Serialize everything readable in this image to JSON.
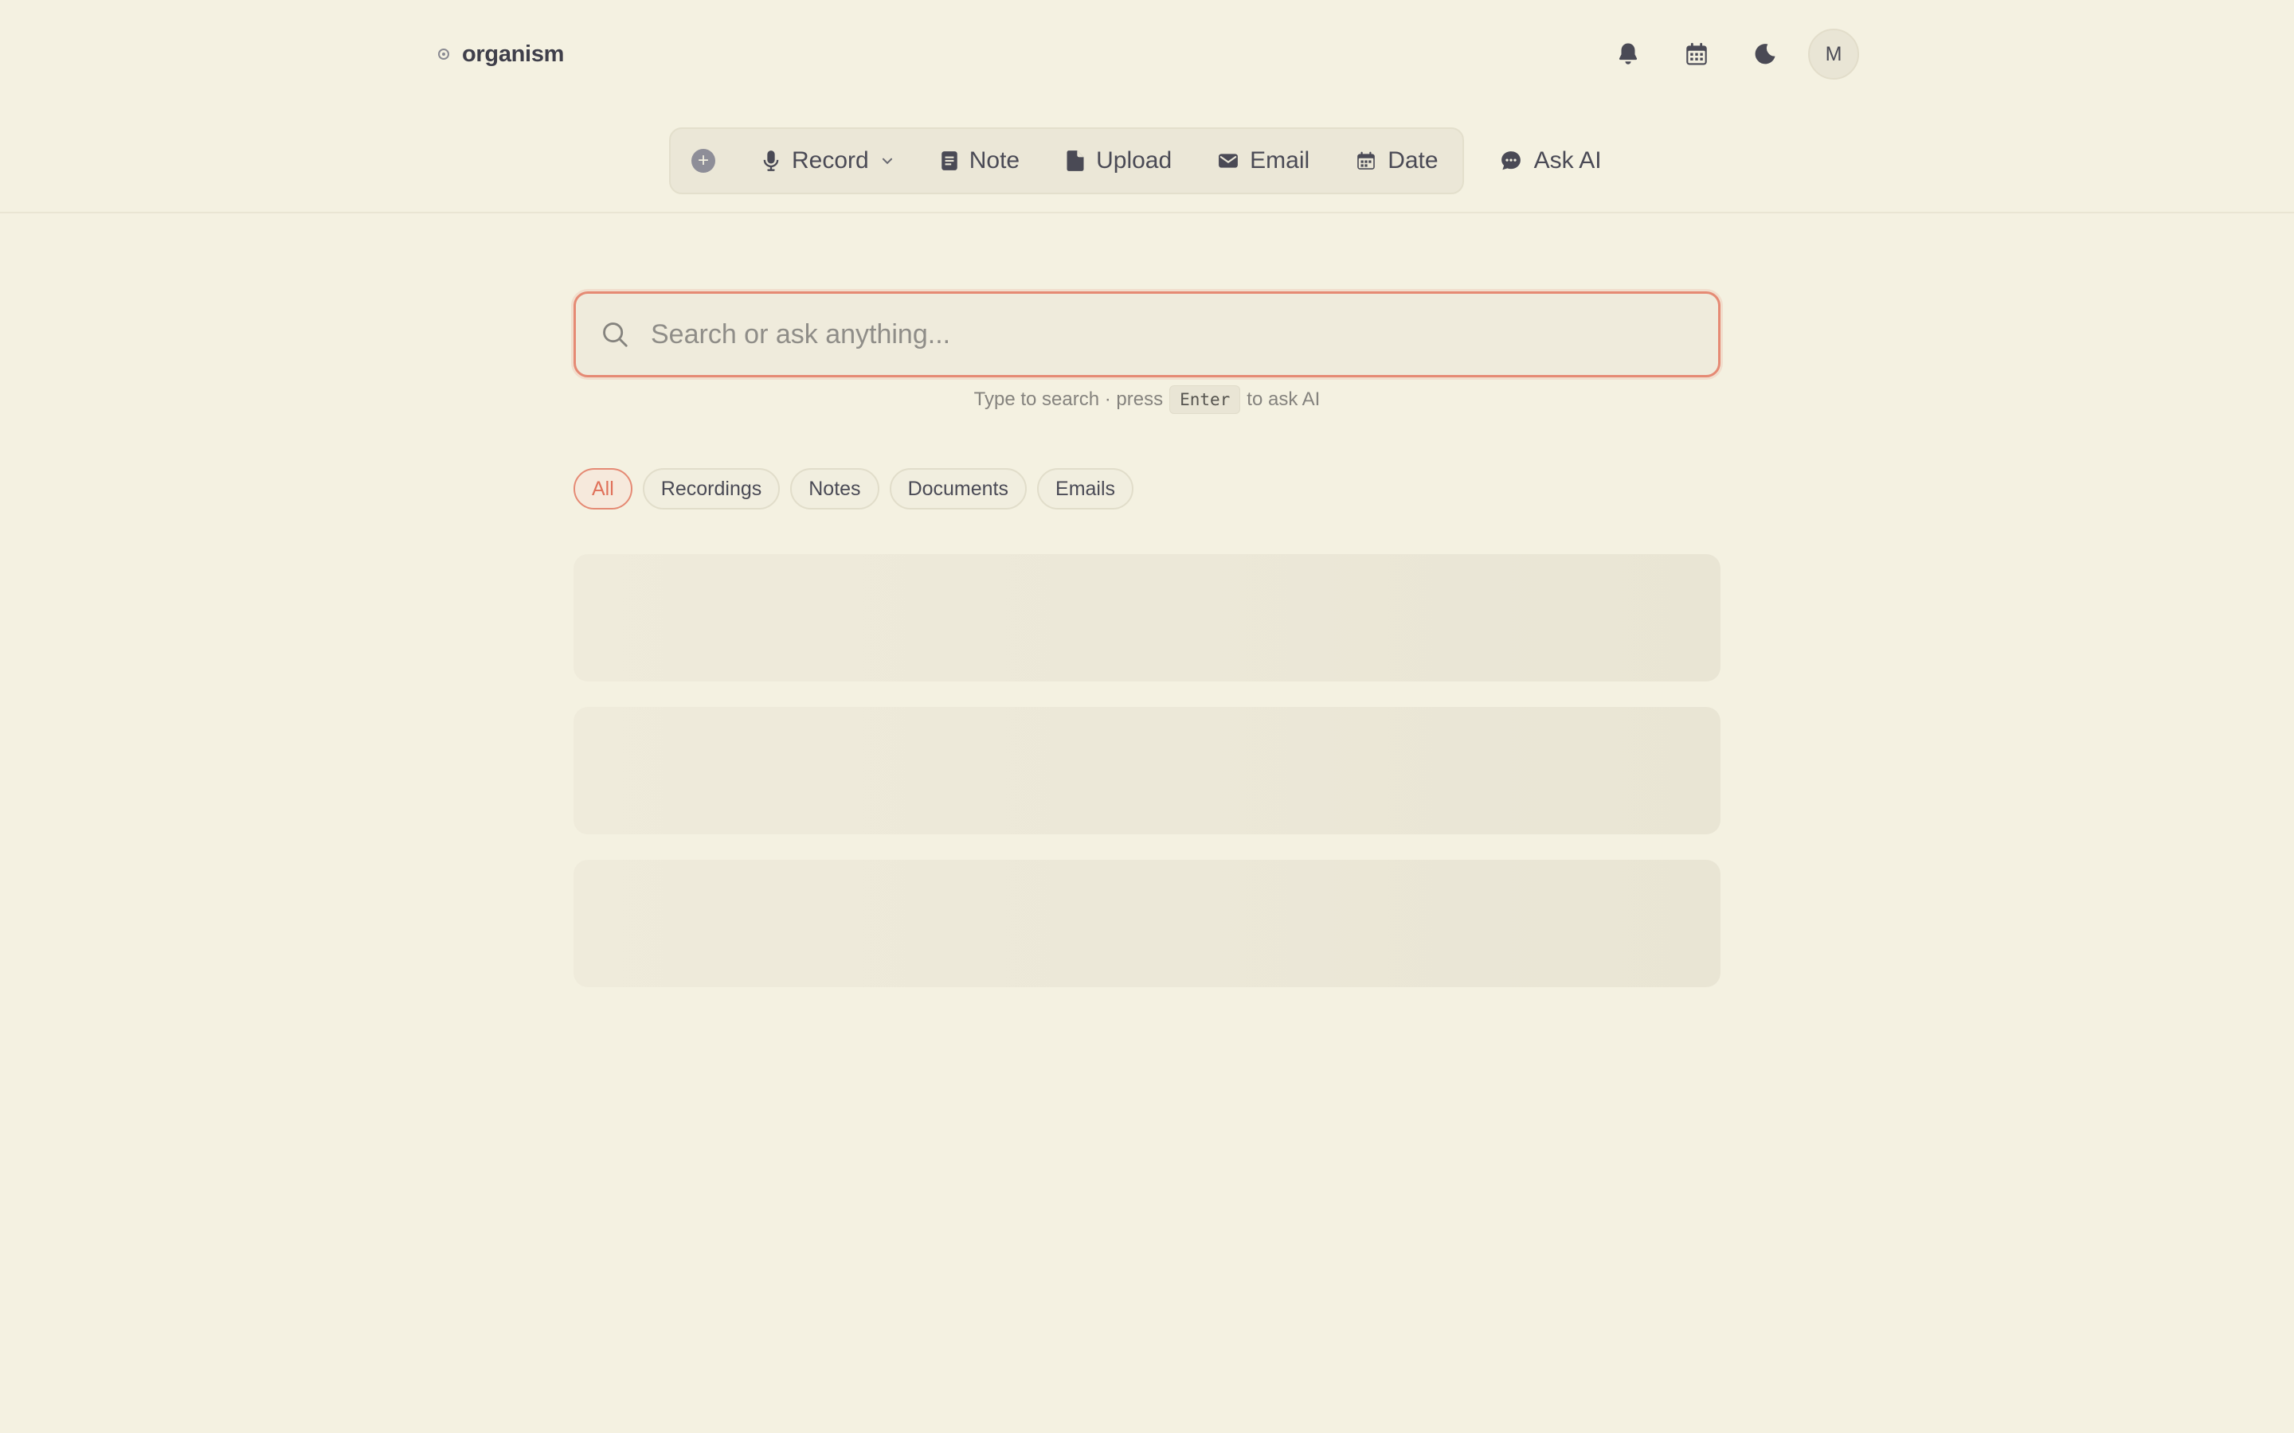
{
  "app": {
    "name": "organism"
  },
  "header": {
    "notifications_icon": "bell-icon",
    "calendar_icon": "calendar-icon",
    "theme_icon": "moon-icon",
    "avatar_initial": "M"
  },
  "toolbar": {
    "add_icon": "plus-circle-icon",
    "record_label": "Record",
    "note_label": "Note",
    "upload_label": "Upload",
    "email_label": "Email",
    "date_label": "Date",
    "ask_ai_label": "Ask AI"
  },
  "search": {
    "placeholder": "Search or ask anything...",
    "value": "",
    "hint_prefix": "Type to search · press",
    "hint_key": "Enter",
    "hint_suffix": "to ask AI"
  },
  "filters": {
    "items": [
      "All",
      "Recordings",
      "Notes",
      "Documents",
      "Emails"
    ],
    "selected": "All"
  },
  "colors": {
    "background": "#f4f1e1",
    "accent": "#e58a74",
    "text": "#4a4a55"
  }
}
